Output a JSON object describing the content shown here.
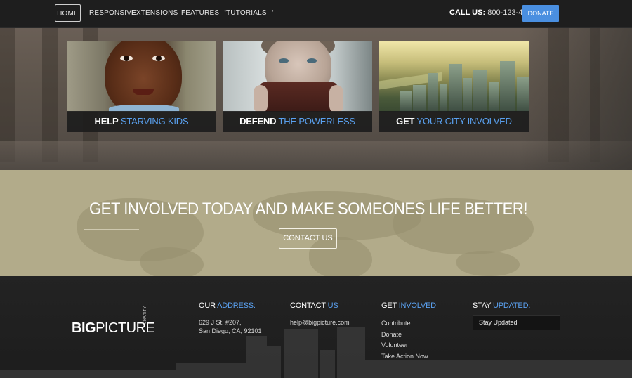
{
  "nav": {
    "items": [
      {
        "label": "HOME"
      },
      {
        "label": "RESPONSIVE"
      },
      {
        "label": "EXTENSIONS",
        "dropdown": true
      },
      {
        "label": "FEATURES",
        "dropdown": true
      },
      {
        "label": "TUTORIALS",
        "dropdown": true
      }
    ],
    "call_label": "CALL US:",
    "call_number": "800-123-4578",
    "donate_label": "DONATE"
  },
  "cards": [
    {
      "bold": "HELP",
      "accent": "STARVING KIDS"
    },
    {
      "bold": "DEFEND",
      "accent": "THE POWERLESS"
    },
    {
      "bold": "GET",
      "accent": "YOUR CITY INVOLVED"
    }
  ],
  "cta": {
    "title": "GET INVOLVED TODAY AND MAKE SOMEONES LIFE BETTER!",
    "button": "CONTACT US"
  },
  "footer": {
    "logo_bold": "BIG",
    "logo_light": "PICTURE",
    "logo_tag": "CHARITY",
    "address": {
      "head": "OUR",
      "accent": "ADDRESS:",
      "line1": "629 J St. #207,",
      "line2": "San Diego, CA, 92101"
    },
    "contact": {
      "head": "CONTACT",
      "accent": "US",
      "email": "help@bigpicture.com"
    },
    "involved": {
      "head": "GET",
      "accent": "INVOLVED",
      "links": [
        "Contribute",
        "Donate",
        "Volunteer",
        "Take Action Now"
      ]
    },
    "updates": {
      "head": "STAY",
      "accent": "UPDATED:",
      "input_value": "Stay Updated"
    }
  },
  "colors": {
    "accent": "#5aa0ef",
    "donate": "#4a8fe0",
    "cta_bg": "#b2ab8a",
    "footer_bg": "#1d1d1d"
  }
}
